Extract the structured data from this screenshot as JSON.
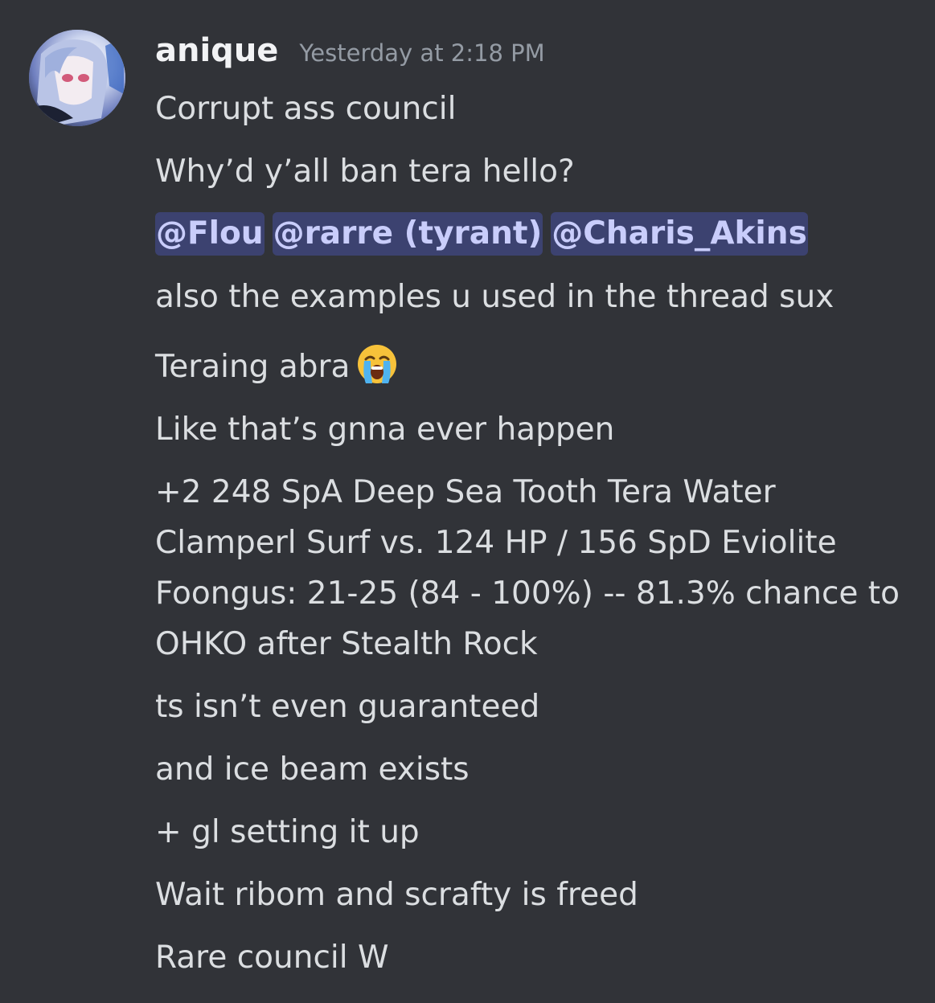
{
  "message": {
    "username": "anique",
    "timestamp": "Yesterday at 2:18 PM",
    "avatar_icon": "anime-avatar-icon",
    "colors": {
      "background": "#313338",
      "text": "#dbdee1",
      "username": "#f2f3f5",
      "timestamp": "#949ba4",
      "mention_bg": "#3c4270",
      "mention_text": "#c9cdfb"
    },
    "lines": {
      "l1": "Corrupt ass council",
      "l2": "Why’d y’all ban tera hello?",
      "mentions": [
        "@Flou",
        "@rarre (tyrant)",
        "@Charis_Akins"
      ],
      "l4": "also the examples u used in the thread sux",
      "l5_text": "Teraing abra",
      "l5_emoji": "loudly-crying-face-icon",
      "l6": "Like that’s gnna ever happen",
      "calc": {
        "a": "+2 248 SpA Deep Sea Tooth Tera Water",
        "b": "Clamperl Surf vs. 124 HP / 156 SpD Eviolite",
        "c": "Foongus: 21-25 (84 - 100%) -- 81.3% chance to",
        "d": "OHKO after Stealth Rock"
      },
      "l8": "ts isn’t even guaranteed",
      "l9": "and ice beam exists",
      "l10": "+ gl setting it up",
      "l11": "Wait ribom and scrafty is freed",
      "l12": "Rare council W"
    }
  }
}
